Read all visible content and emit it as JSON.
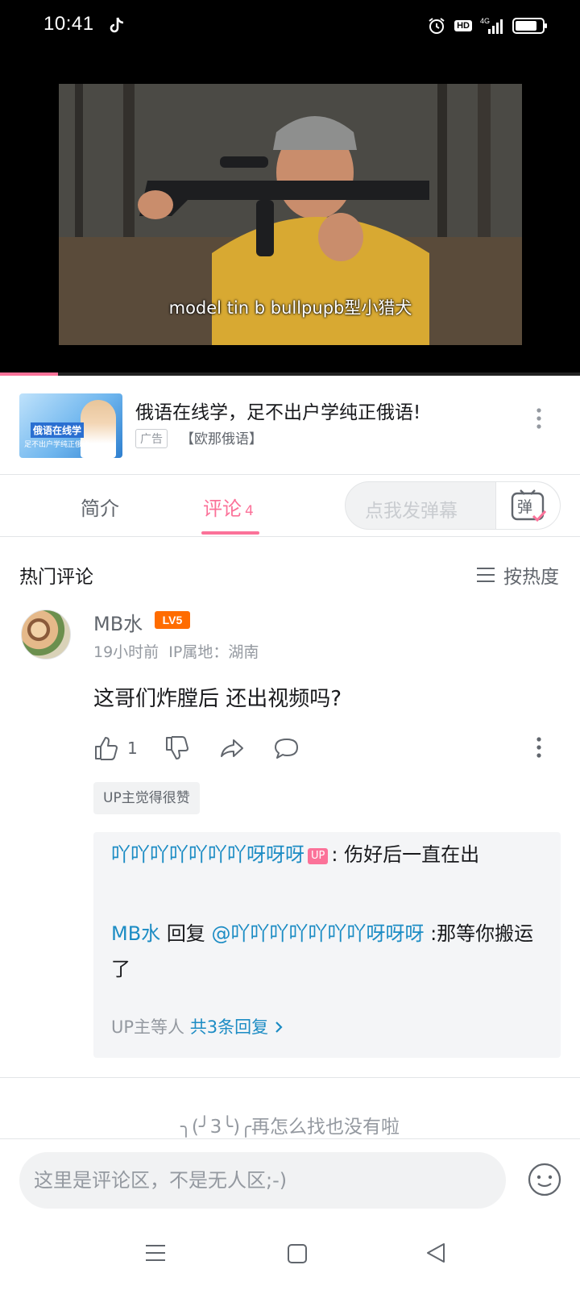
{
  "status_bar": {
    "time": "10:41",
    "hd": "HD",
    "network": "4G",
    "icons": [
      "tiktok-icon",
      "alarm-icon",
      "hd-icon",
      "signal-icon",
      "battery-icon"
    ]
  },
  "video": {
    "subtitle": "model tin b bullpupb型小猎犬",
    "progress_fraction": 0.1
  },
  "ad": {
    "thumb_title": "俄语在线学",
    "thumb_subtitle": "足不出户学纯正俄语",
    "title": "俄语在线学，足不出户学纯正俄语!",
    "badge": "广告",
    "source": "【欧那俄语】"
  },
  "tabs": {
    "intro": "简介",
    "comments": "评论",
    "comments_count": "4",
    "danmaku_placeholder": "点我发弹幕",
    "danmaku_icon_text": "弹"
  },
  "comments": {
    "section_title": "热门评论",
    "sort_label": "按热度",
    "items": [
      {
        "username": "MB水",
        "level": "LV5",
        "time": "19小时前",
        "ip": "IP属地：湖南",
        "text": "这哥们炸膛后 还出视频吗?",
        "likes": "1",
        "tag": "UP主觉得很赞",
        "replies": [
          {
            "author": "吖吖吖吖吖吖吖呀呀呀",
            "author_tag": "UP",
            "text": ": 伤好后一直在出"
          },
          {
            "author": "MB水",
            "action": "回复",
            "mention": "@吖吖吖吖吖吖吖呀呀呀",
            "text": ":那等你搬运了"
          }
        ],
        "reply_summary_prefix": "UP主等人",
        "reply_summary_link": "共3条回复"
      }
    ],
    "end_text": "╮(╯3╰)╭再怎么找也没有啦"
  },
  "input": {
    "placeholder": "这里是评论区，不是无人区;-)"
  },
  "colors": {
    "accent": "#fb7299",
    "link": "#1c8cc4",
    "level_badge": "#ff6c00"
  }
}
